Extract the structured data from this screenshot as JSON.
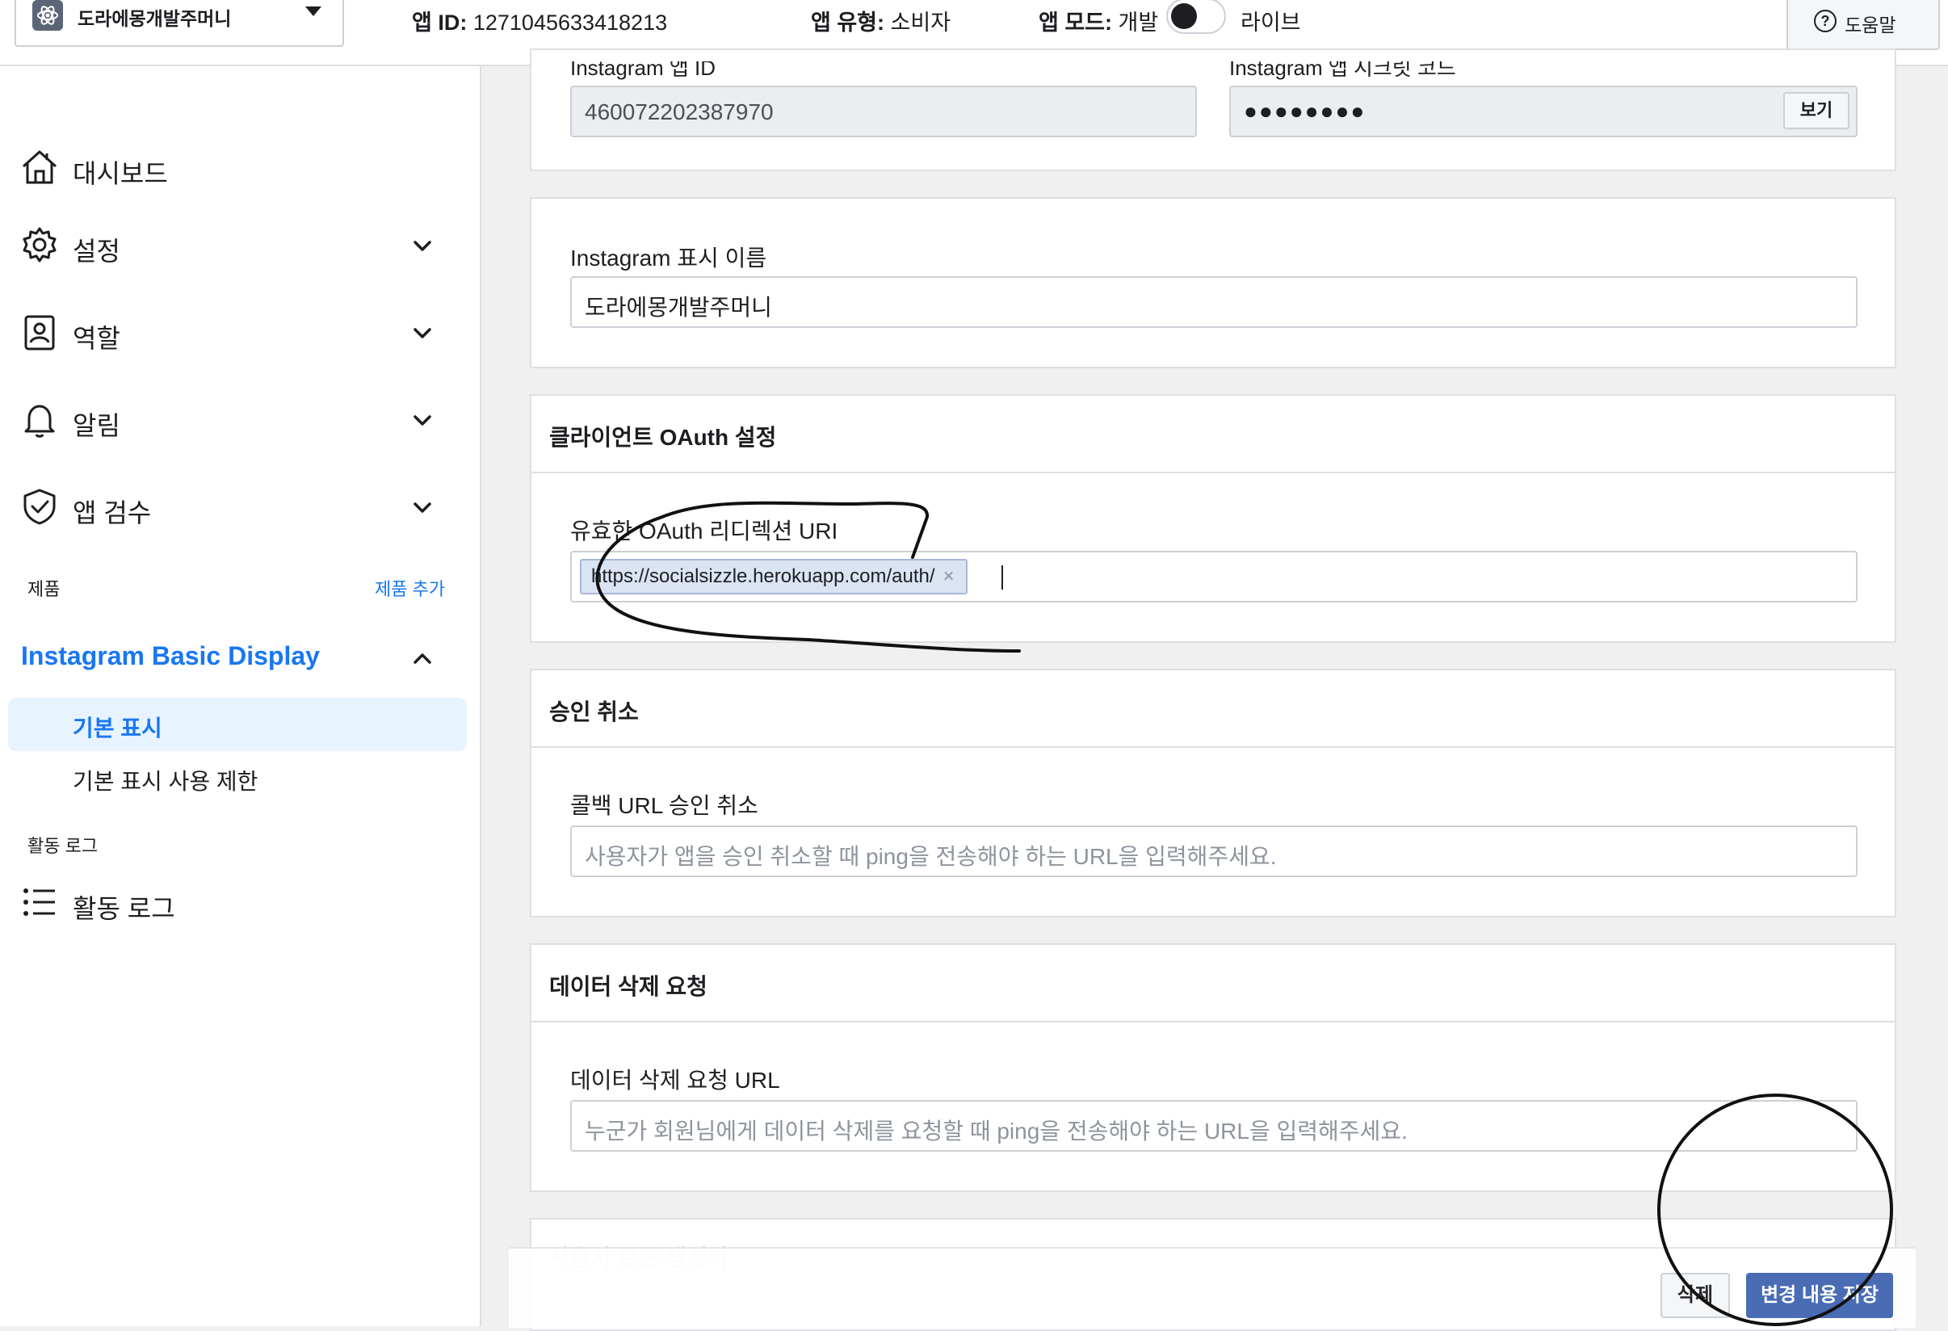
{
  "topbar": {
    "app_name": "도라에몽개발주머니",
    "app_id_label": "앱 ID:",
    "app_id_value": "1271045633418213",
    "app_type_label": "앱 유형:",
    "app_type_value": "소비자",
    "app_mode_label": "앱 모드:",
    "app_mode_value": "개발",
    "mode_live": "라이브",
    "help": "도움말"
  },
  "sidebar": {
    "items": [
      {
        "label": "대시보드",
        "icon": "home-icon"
      },
      {
        "label": "설정",
        "icon": "gear-icon"
      },
      {
        "label": "역할",
        "icon": "person-badge-icon"
      },
      {
        "label": "알림",
        "icon": "bell-icon"
      },
      {
        "label": "앱 검수",
        "icon": "shield-check-icon"
      }
    ],
    "products_label": "제품",
    "add_product": "제품 추가",
    "product_name": "Instagram Basic Display",
    "sub_items": [
      "기본 표시",
      "기본 표시 사용 제한"
    ],
    "activity_section": "활동 로그",
    "activity_item": "활동 로그"
  },
  "main": {
    "top_card": {
      "app_id_label_partial": "Instagram 앱 ID",
      "app_id_value": "460072202387970",
      "secret_label_partial": "Instagram 앱 시크릿 코드",
      "secret_mask": "●●●●●●●●",
      "show_button": "보기"
    },
    "display_name_card": {
      "label": "Instagram 표시 이름",
      "value": "도라에몽개발주머니"
    },
    "oauth_card": {
      "title": "클라이언트 OAuth 설정",
      "label": "유효한 OAuth 리디렉션 URI",
      "tag": "https://socialsizzle.herokuapp.com/auth/",
      "tag_remove": "×"
    },
    "deauth_card": {
      "title": "승인 취소",
      "label": "콜백 URL 승인 취소",
      "placeholder": "사용자가 앱을 승인 취소할 때 ping을 전송해야 하는 URL을 입력해주세요."
    },
    "data_deletion_card": {
      "title": "데이터 삭제 요청",
      "label": "데이터 삭제 요청 URL",
      "placeholder": "누군가 회원님에게 데이터 삭제를 요청할 때 ping을 전송해야 하는 URL을 입력해주세요."
    },
    "token_card_title": "사용자 토큰 생성기"
  },
  "footer": {
    "delete": "삭제",
    "save": "변경 내용 저장"
  },
  "colors": {
    "accent": "#1877f2",
    "primary_button": "#4267b2",
    "tag_bg": "#dbe4f3"
  }
}
